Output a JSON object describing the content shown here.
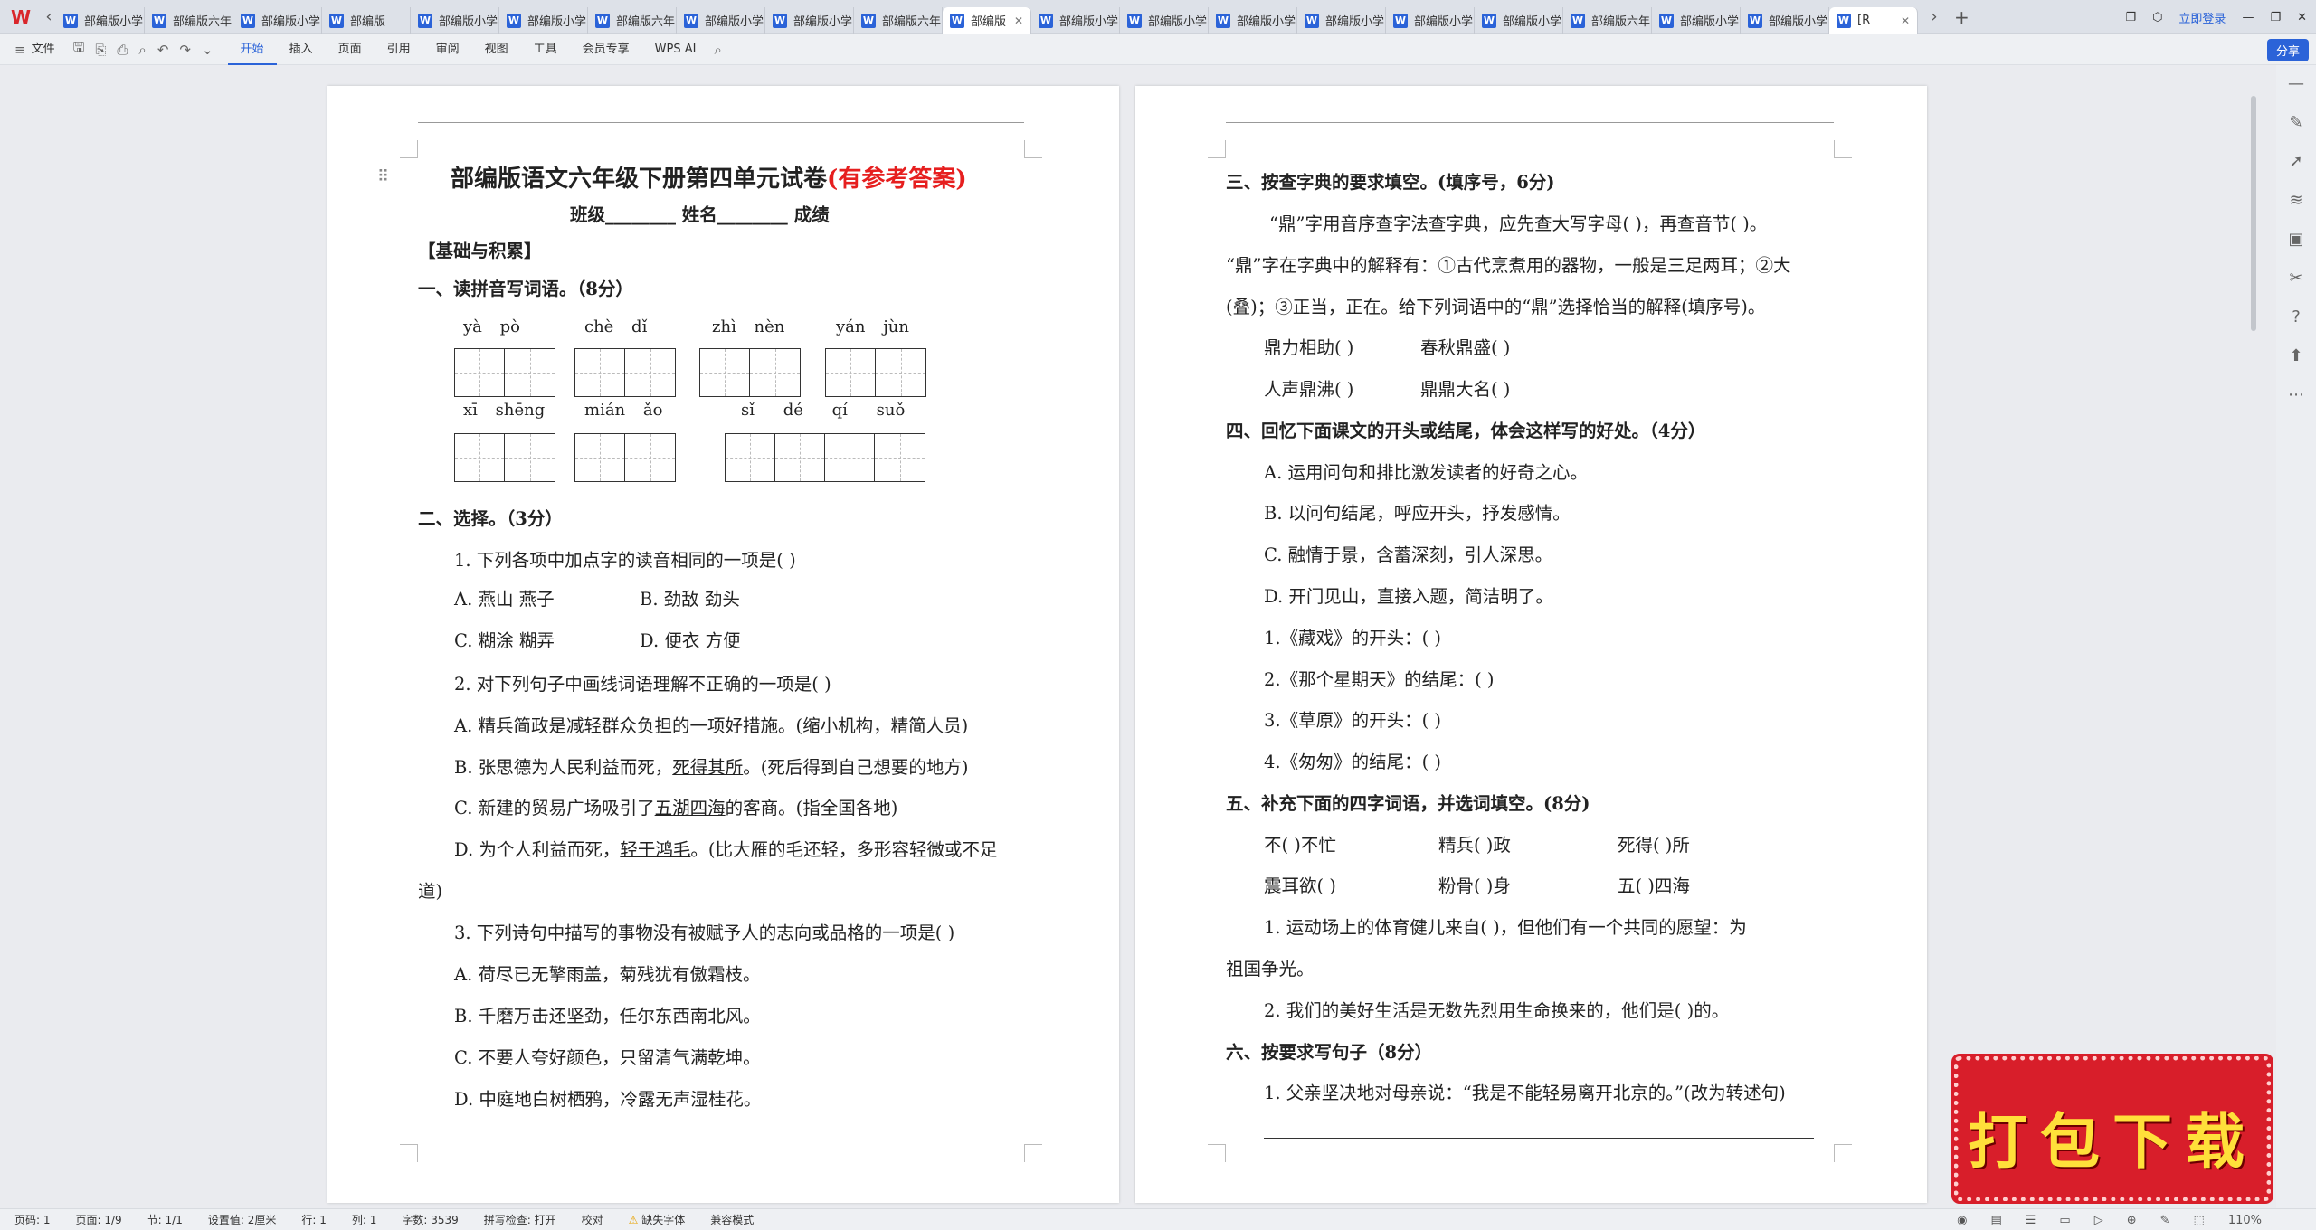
{
  "tabs": {
    "items": [
      "部编版小学",
      "部编版六年",
      "部编版小学",
      "部编版",
      "部编版小学",
      "部编版小学",
      "部编版六年",
      "部编版小学",
      "部编版小学",
      "部编版六年",
      "部编版",
      "部编版小学",
      "部编版小学",
      "部编版小学",
      "部编版小学",
      "部编版小学",
      "部编版小学",
      "部编版六年",
      "部编版小学",
      "部编版小学",
      "[R"
    ],
    "login": "立即登录"
  },
  "toolbar": {
    "file": "文件",
    "menu": [
      "开始",
      "插入",
      "页面",
      "引用",
      "审阅",
      "视图",
      "工具",
      "会员专享"
    ],
    "ai": "WPS AI",
    "share": "分享"
  },
  "page1": {
    "title": "部编版语文六年级下册第四单元试卷",
    "title_red": "(有参考答案)",
    "subtitle": "班级________ 姓名________ 成绩",
    "section_basic": "【基础与积累】",
    "q1": "一、读拼音写词语。（8分）",
    "pinyin_row1": [
      "yà pò",
      "chè dǐ",
      "zhì nèn",
      "yán jùn"
    ],
    "pinyin_row2": [
      "xī shēng",
      "mián ǎo",
      "sǐ dé qí suǒ"
    ],
    "q2": "二、选择。（3分）",
    "q2_1": "1. 下列各项中加点字的读音相同的一项是(    )",
    "q2_1a": "A. 燕山      燕子",
    "q2_1b": "B. 劲敌      劲头",
    "q2_1c": "C. 糊涂      糊弄",
    "q2_1d": "D. 便衣      方便",
    "q2_2": "2. 对下列句子中画线词语理解不正确的一项是(    )",
    "q2_2a_pre": "A. ",
    "q2_2a_u": "精兵简政",
    "q2_2a_post": "是减轻群众负担的一项好措施。(缩小机构，精简人员)",
    "q2_2b_pre": "B. 张思德为人民利益而死，",
    "q2_2b_u": "死得其所",
    "q2_2b_post": "。(死后得到自己想要的地方)",
    "q2_2c_pre": "C. 新建的贸易广场吸引了",
    "q2_2c_u": "五湖四海",
    "q2_2c_post": "的客商。(指全国各地)",
    "q2_2d_pre": "D. 为个人利益而死，",
    "q2_2d_u": "轻于鸿毛",
    "q2_2d_post": "。(比大雁的毛还轻，多形容轻微或不足",
    "q2_2d_cont": "道)",
    "q2_3": "3. 下列诗句中描写的事物没有被赋予人的志向或品格的一项是(    )",
    "q2_3a": "A. 荷尽已无擎雨盖，菊残犹有傲霜枝。",
    "q2_3b": "B. 千磨万击还坚劲，任尔东西南北风。",
    "q2_3c": "C. 不要人夸好颜色，只留清气满乾坤。",
    "q2_3d": "D. 中庭地白树栖鸦，冷露无声湿桂花。"
  },
  "page2": {
    "q3": "三、按查字典的要求填空。(填序号，6分)",
    "q3_l1": "“鼎”字用音序查字法查字典，应先查大写字母(    )，再查音节(    )。",
    "q3_l2": "“鼎”字在字典中的解释有：①古代烹煮用的器物，一般是三足两耳；②大",
    "q3_l3": "(叠)；③正当，正在。给下列词语中的“鼎”选择恰当的解释(填序号)。",
    "q3_w1": "鼎力相助(    )",
    "q3_w2": "春秋鼎盛(    )",
    "q3_w3": "人声鼎沸(    )",
    "q3_w4": "鼎鼎大名(    )",
    "q4": "四、回忆下面课文的开头或结尾，体会这样写的好处。（4分）",
    "q4_a": "A. 运用问句和排比激发读者的好奇之心。",
    "q4_b": "B. 以问句结尾，呼应开头，抒发感情。",
    "q4_c": "C. 融情于景，含蓄深刻，引人深思。",
    "q4_d": "D. 开门见山，直接入题，简洁明了。",
    "q4_1": "1.《藏戏》的开头：(      )",
    "q4_2": "2.《那个星期天》的结尾：(      )",
    "q4_3": "3.《草原》的开头：(      )",
    "q4_4": "4.《匆匆》的结尾：(      )",
    "q5": "五、补充下面的四字词语，并选词填空。(8分)",
    "q5_w1": "不(    )不忙",
    "q5_w2": "精兵(    )政",
    "q5_w3": "死得(    )所",
    "q5_w4": "震耳欲(    )",
    "q5_w5": "粉骨(    )身",
    "q5_w6": "五(    )四海",
    "q5_1": "1. 运动场上的体育健儿来自(          )，但他们有一个共同的愿望：为",
    "q5_1c": "祖国争光。",
    "q5_2": "2. 我们的美好生活是无数先烈用生命换来的，他们是(          )的。",
    "q6": "六、按要求写句子（8分）",
    "q6_1": "1. 父亲坚决地对母亲说：“我是不能轻易离开北京的。”(改为转述句)"
  },
  "status": {
    "items": [
      "页码: 1",
      "页面: 1/9",
      "节: 1/1",
      "设置值: 2厘米",
      "行: 1",
      "列: 1",
      "字数: 3539",
      "拼写检查: 打开",
      "校对",
      "缺失字体",
      "兼容模式"
    ],
    "zoom": "110%"
  },
  "banner": {
    "text": "打包下载"
  },
  "colors": {
    "accent": "#2b63d8",
    "title_red": "#e61f1f",
    "banner": "#d81e2a"
  }
}
